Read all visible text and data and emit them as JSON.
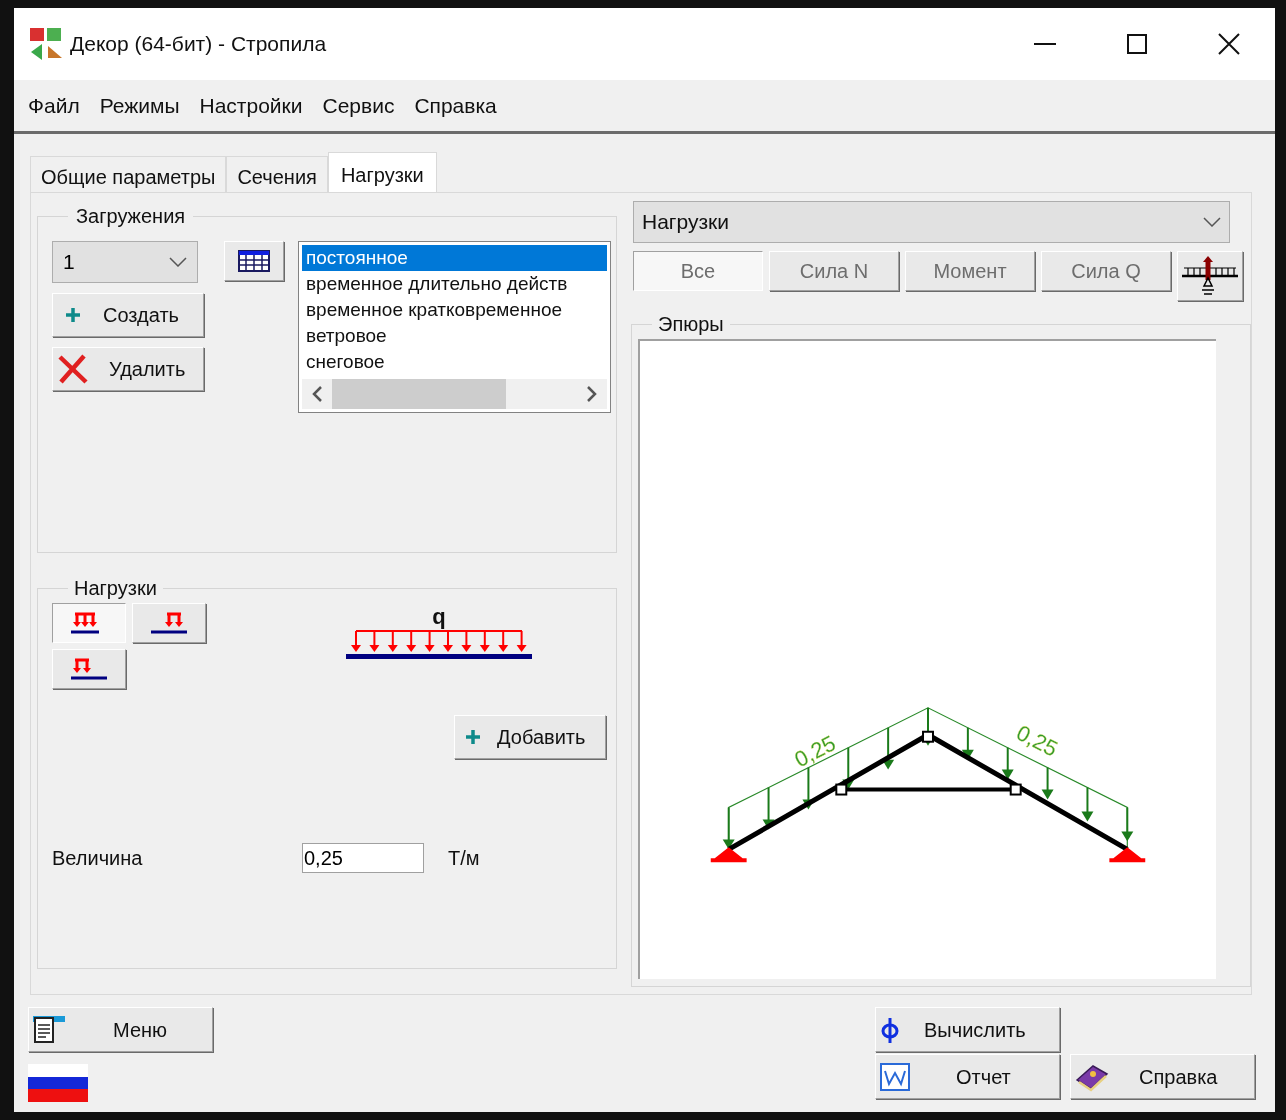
{
  "window": {
    "title": "Декор (64-бит) - Стропила"
  },
  "menu": [
    "Файл",
    "Режимы",
    "Настройки",
    "Сервис",
    "Справка"
  ],
  "tabs": [
    {
      "label": "Общие параметры",
      "selected": false
    },
    {
      "label": "Сечения",
      "selected": false
    },
    {
      "label": "Нагрузки",
      "selected": true
    }
  ],
  "load_cases": {
    "title": "Загружения",
    "number": "1",
    "create_button": "Создать",
    "delete_button": "Удалить",
    "items": [
      {
        "label": "постоянное",
        "selected": true
      },
      {
        "label": "временное длительно действ",
        "selected": false
      },
      {
        "label": "временное кратковременное",
        "selected": false
      },
      {
        "label": "ветровое",
        "selected": false
      },
      {
        "label": "снеговое",
        "selected": false
      }
    ]
  },
  "loads": {
    "title": "Нагрузки",
    "types": [
      {
        "kind": "full",
        "selected": true
      },
      {
        "kind": "right",
        "selected": false
      },
      {
        "kind": "left",
        "selected": false
      }
    ],
    "diagram_label": "q",
    "add_button": "Добавить",
    "magnitude_label": "Величина",
    "magnitude": "0,25",
    "unit": "Т/м"
  },
  "view": {
    "dropdown": "Нагрузки",
    "buttons": [
      {
        "label": "Все",
        "selected": true,
        "disabled": true
      },
      {
        "label": "Сила N",
        "selected": false,
        "disabled": true
      },
      {
        "label": "Момент",
        "selected": false,
        "disabled": true
      },
      {
        "label": "Сила Q",
        "selected": false,
        "disabled": true
      }
    ],
    "diagrams_title": "Эпюры",
    "value_labels": [
      "0,25",
      "0,25"
    ]
  },
  "bottom_buttons": {
    "menu": "Меню",
    "calculate": "Вычислить",
    "report": "Отчет",
    "help": "Справка"
  }
}
